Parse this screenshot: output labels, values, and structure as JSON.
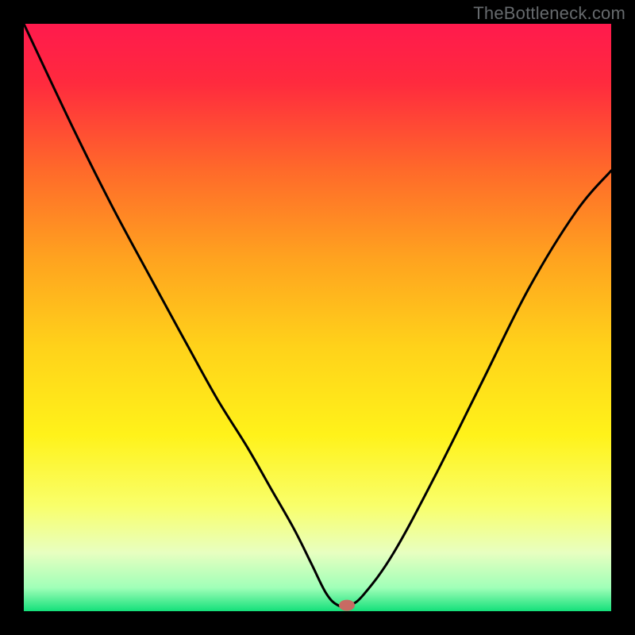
{
  "watermark": "TheBottleneck.com",
  "chart_data": {
    "type": "line",
    "title": "",
    "xlabel": "",
    "ylabel": "",
    "xlim": [
      0,
      100
    ],
    "ylim": [
      0,
      100
    ],
    "x": [
      0,
      8.5,
      15,
      22,
      28,
      33,
      38,
      42,
      46,
      49,
      51.5,
      53.5,
      55.5,
      58,
      63,
      70,
      78,
      86,
      94,
      100
    ],
    "values": [
      100,
      82,
      69,
      56,
      45,
      36,
      28,
      21,
      14,
      8,
      3,
      1,
      1,
      3,
      10,
      23,
      39,
      55,
      68,
      75
    ],
    "marker": {
      "x": 55,
      "y": 1,
      "color": "#c86a63"
    },
    "gradient_stops": [
      {
        "offset": 0.0,
        "color": "#ff1a4d"
      },
      {
        "offset": 0.1,
        "color": "#ff2a3e"
      },
      {
        "offset": 0.25,
        "color": "#ff6a2a"
      },
      {
        "offset": 0.4,
        "color": "#ffa31f"
      },
      {
        "offset": 0.55,
        "color": "#ffd21a"
      },
      {
        "offset": 0.7,
        "color": "#fff21a"
      },
      {
        "offset": 0.82,
        "color": "#f9ff6a"
      },
      {
        "offset": 0.9,
        "color": "#e8ffc0"
      },
      {
        "offset": 0.96,
        "color": "#a0ffb8"
      },
      {
        "offset": 1.0,
        "color": "#14e07a"
      }
    ]
  }
}
